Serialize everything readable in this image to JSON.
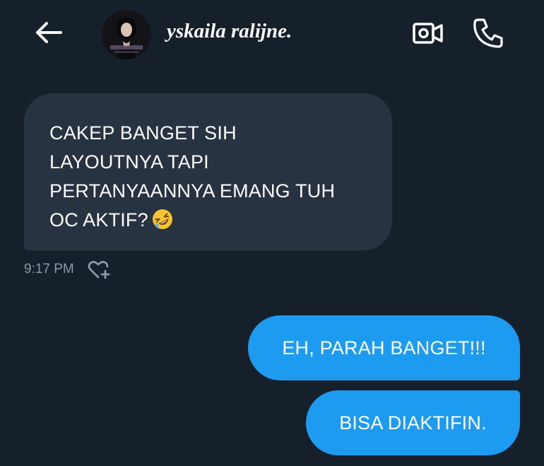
{
  "header": {
    "contact_name": "yskaila ralijne.",
    "back_icon": "arrow-left-icon",
    "video_icon": "video-camera-icon",
    "call_icon": "phone-icon"
  },
  "messages": {
    "received": {
      "lines": [
        "CAKEP BANGET SIH",
        "LAYOUTNYA TAPI",
        "PERTANYAANNYA EMANG TUH",
        "OC AKTIF?"
      ],
      "emoji": "rolling-on-the-floor-laughing-emoji",
      "timestamp": "9:17 PM",
      "react_icon": "heart-plus-icon"
    },
    "sent": [
      {
        "text": "EH, PARAH BANGET!!!"
      },
      {
        "text": "BISA DIAKTIFIN."
      }
    ]
  },
  "colors": {
    "background": "#15202b",
    "received_bubble": "#273340",
    "sent_bubble": "#1d9bf0",
    "secondary_text": "#8b98a5",
    "text": "#ffffff"
  }
}
